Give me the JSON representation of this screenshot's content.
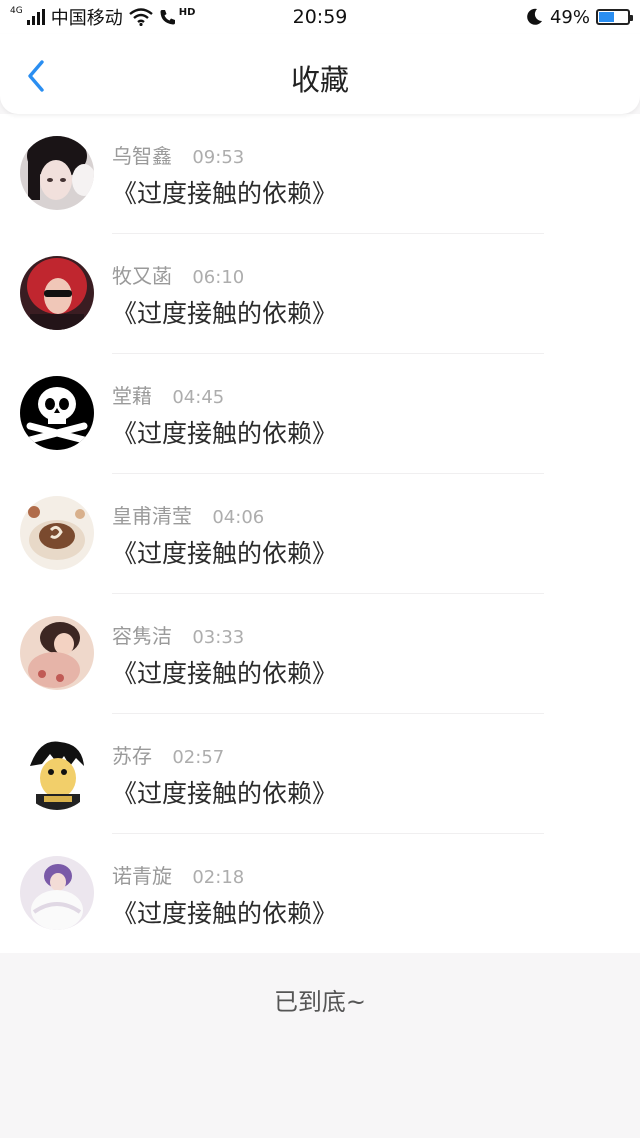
{
  "status_bar": {
    "network": "4G",
    "carrier": "中国移动",
    "time": "20:59",
    "battery_percent": "49%",
    "battery_level": 0.49,
    "icons": [
      "signal-icon",
      "wifi-icon",
      "call-icon",
      "moon-icon",
      "battery-icon"
    ]
  },
  "nav": {
    "back_icon": "chevron-left-icon",
    "title": "收藏",
    "accent_color": "#2a8ef1"
  },
  "items": [
    {
      "name": "乌智鑫",
      "time": "09:53",
      "title": "《过度接触的依赖》"
    },
    {
      "name": "牧又菡",
      "time": "06:10",
      "title": "《过度接触的依赖》"
    },
    {
      "name": "堂藉",
      "time": "04:45",
      "title": "《过度接触的依赖》"
    },
    {
      "name": "皇甫清莹",
      "time": "04:06",
      "title": "《过度接触的依赖》"
    },
    {
      "name": "容隽洁",
      "time": "03:33",
      "title": "《过度接触的依赖》"
    },
    {
      "name": "苏存",
      "time": "02:57",
      "title": "《过度接触的依赖》"
    },
    {
      "name": "诺青旋",
      "time": "02:18",
      "title": "《过度接触的依赖》"
    }
  ],
  "footer": {
    "end_text": "已到底~"
  }
}
